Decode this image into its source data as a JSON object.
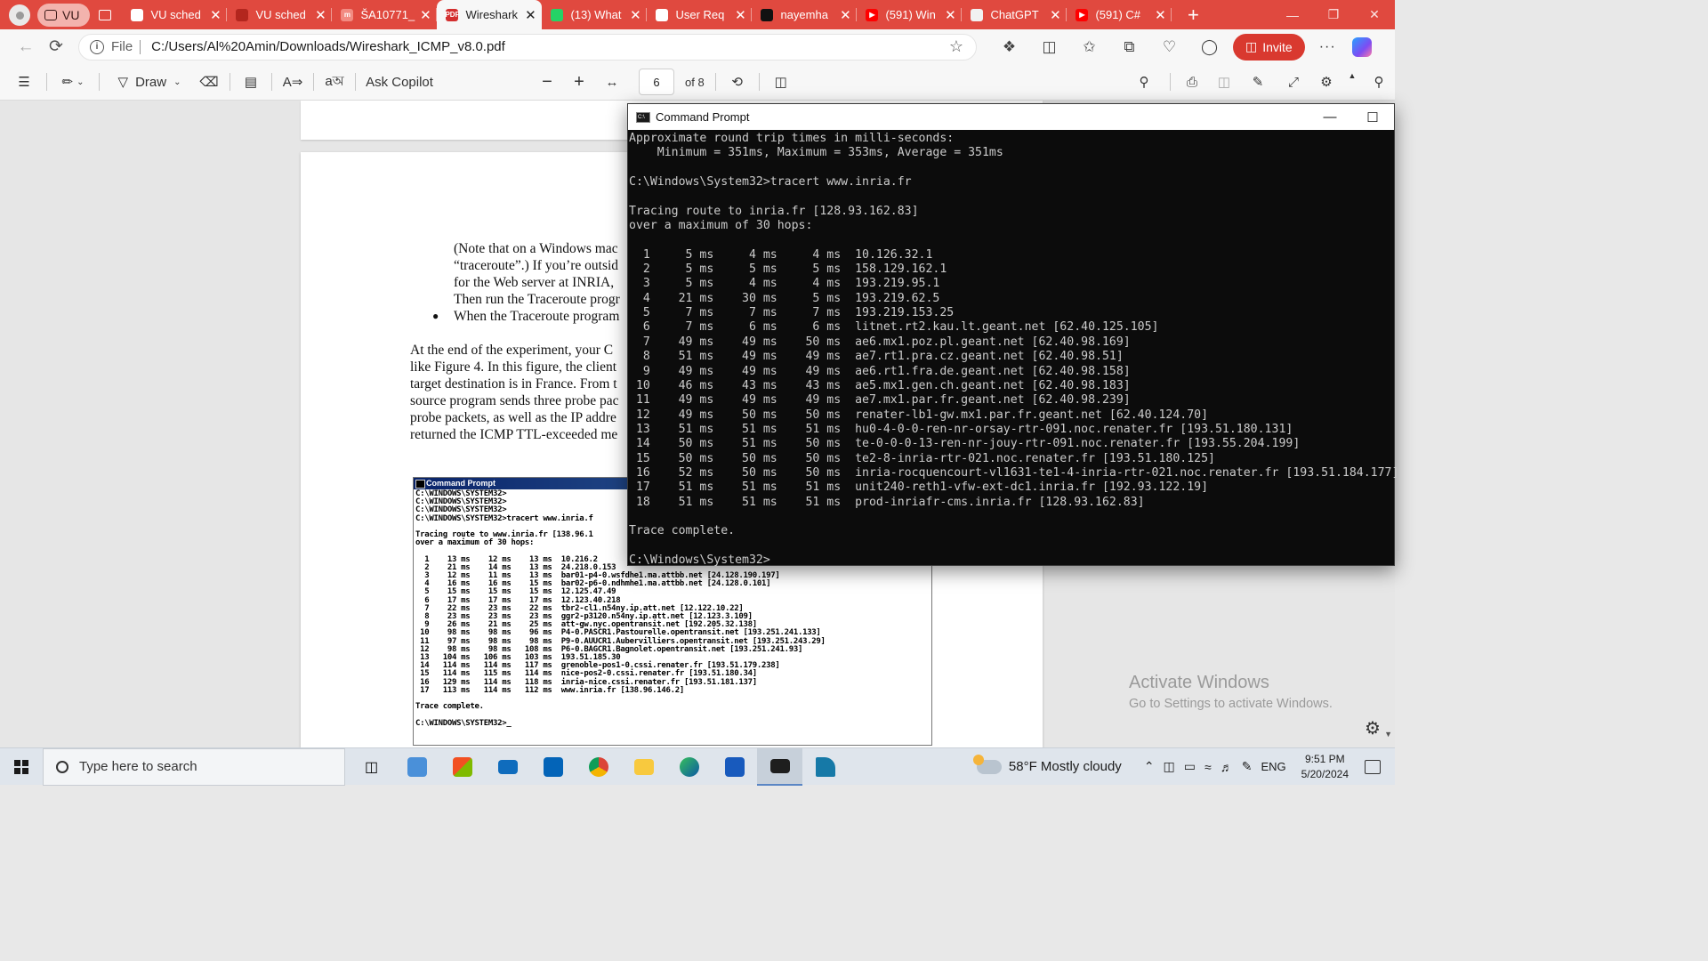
{
  "browser": {
    "workspace_label": "VU",
    "tabs": [
      {
        "label": "VU sched",
        "fav_color": "#ffffff",
        "fav_text": ""
      },
      {
        "label": "VU sched",
        "fav_color": "#b3261e",
        "fav_text": ""
      },
      {
        "label": "ŠA10771_",
        "fav_color": "#f28b82",
        "fav_text": "m"
      },
      {
        "label": "Wireshark",
        "fav_color": "#d32f2f",
        "fav_text": "PDF",
        "active": true
      },
      {
        "label": "(13) What",
        "fav_color": "#25d366",
        "fav_text": ""
      },
      {
        "label": "User Req",
        "fav_color": "#ffffff",
        "fav_text": ""
      },
      {
        "label": "nayemha",
        "fav_color": "#111111",
        "fav_text": ""
      },
      {
        "label": "(591) Win",
        "fav_color": "#ff0000",
        "fav_text": "▶"
      },
      {
        "label": "ChatGPT",
        "fav_color": "#f1f1f1",
        "fav_text": ""
      },
      {
        "label": "(591) C#",
        "fav_color": "#ff0000",
        "fav_text": "▶"
      }
    ],
    "address": {
      "scheme": "File",
      "url": "C:/Users/Al%20Amin/Downloads/Wireshark_ICMP_v8.0.pdf"
    },
    "invite_label": "Invite"
  },
  "pdf_toolbar": {
    "draw_label": "Draw",
    "ask_copilot_label": "Ask Copilot",
    "page_number": "6",
    "page_total": "of 8"
  },
  "pdf_page": {
    "para1_lines": [
      "(Note that on a Windows mac",
      "“traceroute”.) If you’re outsid",
      "for the Web server at INRIA,",
      "Then run the Traceroute progr"
    ],
    "bullet_text": "When the Traceroute program",
    "para2_lines": [
      "At the end of the experiment, your C",
      "like Figure 4. In this figure, the client",
      "target destination is in France. From t",
      "source program sends three probe pac",
      "probe packets, as well as the IP addre",
      "returned the ICMP TTL-exceeded me"
    ],
    "figure_title": "Command Prompt",
    "figure_text": "C:\\WINDOWS\\SYSTEM32>\nC:\\WINDOWS\\SYSTEM32>\nC:\\WINDOWS\\SYSTEM32>\nC:\\WINDOWS\\SYSTEM32>tracert www.inria.f\n\nTracing route to www.inria.fr [138.96.1\nover a maximum of 30 hops:\n\n  1    13 ms    12 ms    13 ms  10.216.2\n  2    21 ms    14 ms    13 ms  24.218.0.153\n  3    12 ms    11 ms    13 ms  bar01-p4-0.wsfdhe1.ma.attbb.net [24.128.190.197]\n  4    16 ms    16 ms    15 ms  bar02-p6-0.ndhmhe1.ma.attbb.net [24.128.0.101]\n  5    15 ms    15 ms    15 ms  12.125.47.49\n  6    17 ms    17 ms    17 ms  12.123.40.218\n  7    22 ms    23 ms    22 ms  tbr2-cl1.n54ny.ip.att.net [12.122.10.22]\n  8    23 ms    23 ms    23 ms  ggr2-p3120.n54ny.ip.att.net [12.123.3.109]\n  9    26 ms    21 ms    25 ms  att-gw.nyc.opentransit.net [192.205.32.138]\n 10    98 ms    98 ms    96 ms  P4-0.PASCR1.Pastourelle.opentransit.net [193.251.241.133]\n 11    97 ms    98 ms    98 ms  P9-0.AUUCR1.Aubervilliers.opentransit.net [193.251.243.29]\n 12    98 ms    98 ms   108 ms  P6-0.BAGCR1.Bagnolet.opentransit.net [193.251.241.93]\n 13   104 ms   106 ms   103 ms  193.51.185.30\n 14   114 ms   114 ms   117 ms  grenoble-pos1-0.cssi.renater.fr [193.51.179.238]\n 15   114 ms   115 ms   114 ms  nice-pos2-0.cssi.renater.fr [193.51.180.34]\n 16   129 ms   114 ms   118 ms  inria-nice.cssi.renater.fr [193.51.181.137]\n 17   113 ms   114 ms   112 ms  www.inria.fr [138.96.146.2]\n\nTrace complete.\n\nC:\\WINDOWS\\SYSTEM32>_"
  },
  "watermark": {
    "line1": "Activate Windows",
    "line2": "Go to Settings to activate Windows."
  },
  "cmd": {
    "title": "Command Prompt",
    "output": "Approximate round trip times in milli-seconds:\n    Minimum = 351ms, Maximum = 353ms, Average = 351ms\n\nC:\\Windows\\System32>tracert www.inria.fr\n\nTracing route to inria.fr [128.93.162.83]\nover a maximum of 30 hops:\n\n  1     5 ms     4 ms     4 ms  10.126.32.1\n  2     5 ms     5 ms     5 ms  158.129.162.1\n  3     5 ms     4 ms     4 ms  193.219.95.1\n  4    21 ms    30 ms     5 ms  193.219.62.5\n  5     7 ms     7 ms     7 ms  193.219.153.25\n  6     7 ms     6 ms     6 ms  litnet.rt2.kau.lt.geant.net [62.40.125.105]\n  7    49 ms    49 ms    50 ms  ae6.mx1.poz.pl.geant.net [62.40.98.169]\n  8    51 ms    49 ms    49 ms  ae7.rt1.pra.cz.geant.net [62.40.98.51]\n  9    49 ms    49 ms    49 ms  ae6.rt1.fra.de.geant.net [62.40.98.158]\n 10    46 ms    43 ms    43 ms  ae5.mx1.gen.ch.geant.net [62.40.98.183]\n 11    49 ms    49 ms    49 ms  ae7.mx1.par.fr.geant.net [62.40.98.239]\n 12    49 ms    50 ms    50 ms  renater-lb1-gw.mx1.par.fr.geant.net [62.40.124.70]\n 13    51 ms    51 ms    51 ms  hu0-4-0-0-ren-nr-orsay-rtr-091.noc.renater.fr [193.51.180.131]\n 14    50 ms    51 ms    50 ms  te-0-0-0-13-ren-nr-jouy-rtr-091.noc.renater.fr [193.55.204.199]\n 15    50 ms    50 ms    50 ms  te2-8-inria-rtr-021.noc.renater.fr [193.51.180.125]\n 16    52 ms    50 ms    50 ms  inria-rocquencourt-vl1631-te1-4-inria-rtr-021.noc.renater.fr [193.51.184.177]\n 17    51 ms    51 ms    51 ms  unit240-reth1-vfw-ext-dc1.inria.fr [192.93.122.19]\n 18    51 ms    51 ms    51 ms  prod-inriafr-cms.inria.fr [128.93.162.83]\n\nTrace complete.\n\nC:\\Windows\\System32>"
  },
  "taskbar": {
    "search_placeholder": "Type here to search",
    "weather": "58°F  Mostly cloudy",
    "language": "ENG",
    "time": "9:51 PM",
    "date": "5/20/2024"
  }
}
